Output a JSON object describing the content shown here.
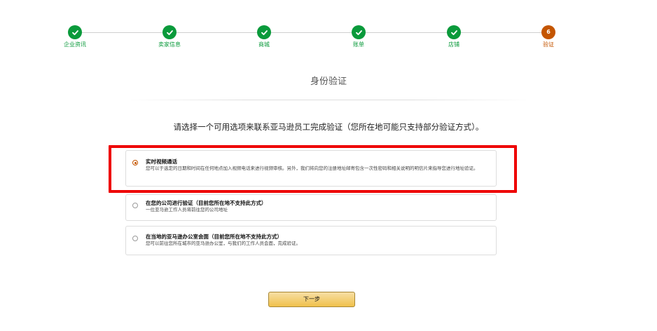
{
  "stepper": {
    "steps": [
      {
        "label": "企业资讯",
        "state": "done",
        "icon": "checkmark-icon"
      },
      {
        "label": "卖家信息",
        "state": "done",
        "icon": "checkmark-icon"
      },
      {
        "label": "商城",
        "state": "done",
        "icon": "checkmark-icon"
      },
      {
        "label": "账单",
        "state": "done",
        "icon": "checkmark-icon"
      },
      {
        "label": "店铺",
        "state": "done",
        "icon": "checkmark-icon"
      },
      {
        "label": "验证",
        "state": "current",
        "number": "6"
      }
    ]
  },
  "colors": {
    "done": "#0a9a3b",
    "current": "#c45500",
    "highlight": "#ee0000",
    "button": "#f0c14b"
  },
  "page": {
    "title": "身份验证",
    "instruction": "请选择一个可用选项来联系亚马逊员工完成验证（您所在地可能只支持部分验证方式）。"
  },
  "options": [
    {
      "title": "实时视频通话",
      "description": "您可以于选定的日期和时间在任何地点加入视频电话来进行视频审核。另外，我们将向您的注册地址邮寄包含一次性密码和相关说明的明信片来指导您进行地址验证。",
      "selected": true
    },
    {
      "title": "在您的公司进行验证（目前您所在地不支持此方式）",
      "description": "一位亚马逊工作人员将前往您的公司地址",
      "selected": false
    },
    {
      "title": "在当地的亚马逊办公室会面（目前您所在地不支持此方式）",
      "description": "您可以前往您所在城市的亚马逊办公室，与我们的工作人员会面，完成验证。",
      "selected": false
    }
  ],
  "actions": {
    "next_label": "下一步"
  }
}
